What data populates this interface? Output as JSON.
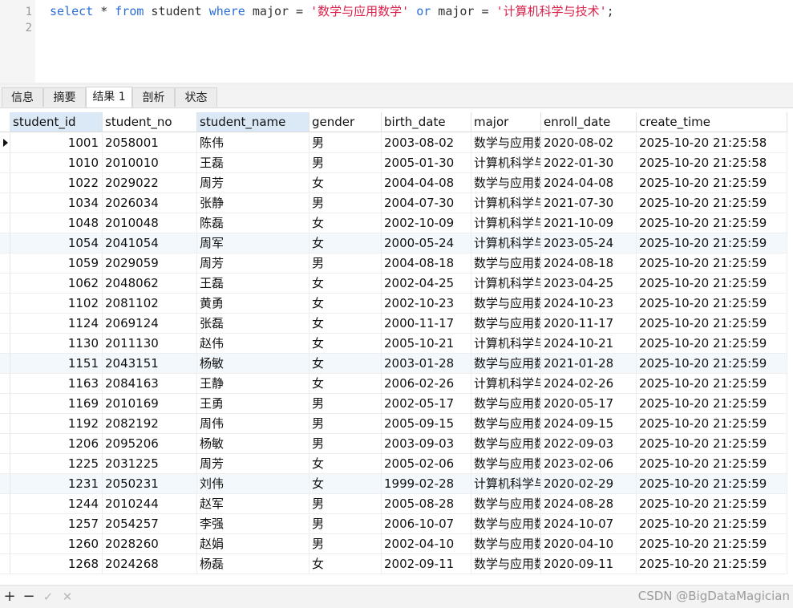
{
  "editor": {
    "line_numbers": [
      "1",
      "2"
    ],
    "sql": {
      "kw_select": "select",
      "t1": " * ",
      "kw_from": "from",
      "t2": " student ",
      "kw_where": "where",
      "t3": " major = ",
      "str1": "'数学与应用数学'",
      "t4": " ",
      "kw_or": "or",
      "t5": " major = ",
      "str2": "'计算机科学与技术'",
      "t6": ";"
    }
  },
  "tabs": [
    {
      "label": "信息"
    },
    {
      "label": "摘要"
    },
    {
      "label": "结果 1"
    },
    {
      "label": "剖析"
    },
    {
      "label": "状态"
    }
  ],
  "grid": {
    "columns": [
      "student_id",
      "student_no",
      "student_name",
      "gender",
      "birth_date",
      "major",
      "enroll_date",
      "create_time"
    ],
    "rows": [
      [
        "1001",
        "2058001",
        "陈伟",
        "男",
        "2003-08-02",
        "数学与应用数",
        "2020-08-02",
        "2025-10-20 21:25:58"
      ],
      [
        "1010",
        "2010010",
        "王磊",
        "男",
        "2005-01-30",
        "计算机科学与",
        "2022-01-30",
        "2025-10-20 21:25:58"
      ],
      [
        "1022",
        "2029022",
        "周芳",
        "女",
        "2004-04-08",
        "数学与应用数",
        "2024-04-08",
        "2025-10-20 21:25:59"
      ],
      [
        "1034",
        "2026034",
        "张静",
        "男",
        "2004-07-30",
        "计算机科学与",
        "2021-07-30",
        "2025-10-20 21:25:59"
      ],
      [
        "1048",
        "2010048",
        "陈磊",
        "女",
        "2002-10-09",
        "计算机科学与",
        "2021-10-09",
        "2025-10-20 21:25:59"
      ],
      [
        "1054",
        "2041054",
        "周军",
        "女",
        "2000-05-24",
        "计算机科学与",
        "2023-05-24",
        "2025-10-20 21:25:59"
      ],
      [
        "1059",
        "2029059",
        "周芳",
        "男",
        "2004-08-18",
        "数学与应用数",
        "2024-08-18",
        "2025-10-20 21:25:59"
      ],
      [
        "1062",
        "2048062",
        "王磊",
        "女",
        "2002-04-25",
        "计算机科学与",
        "2023-04-25",
        "2025-10-20 21:25:59"
      ],
      [
        "1102",
        "2081102",
        "黄勇",
        "女",
        "2002-10-23",
        "数学与应用数",
        "2024-10-23",
        "2025-10-20 21:25:59"
      ],
      [
        "1124",
        "2069124",
        "张磊",
        "女",
        "2000-11-17",
        "数学与应用数",
        "2020-11-17",
        "2025-10-20 21:25:59"
      ],
      [
        "1130",
        "2011130",
        "赵伟",
        "女",
        "2005-10-21",
        "计算机科学与",
        "2024-10-21",
        "2025-10-20 21:25:59"
      ],
      [
        "1151",
        "2043151",
        "杨敏",
        "女",
        "2003-01-28",
        "数学与应用数",
        "2021-01-28",
        "2025-10-20 21:25:59"
      ],
      [
        "1163",
        "2084163",
        "王静",
        "女",
        "2006-02-26",
        "计算机科学与",
        "2024-02-26",
        "2025-10-20 21:25:59"
      ],
      [
        "1169",
        "2010169",
        "王勇",
        "男",
        "2002-05-17",
        "数学与应用数",
        "2020-05-17",
        "2025-10-20 21:25:59"
      ],
      [
        "1192",
        "2082192",
        "周伟",
        "男",
        "2005-09-15",
        "数学与应用数",
        "2024-09-15",
        "2025-10-20 21:25:59"
      ],
      [
        "1206",
        "2095206",
        "杨敏",
        "男",
        "2003-09-03",
        "数学与应用数",
        "2022-09-03",
        "2025-10-20 21:25:59"
      ],
      [
        "1225",
        "2031225",
        "周芳",
        "女",
        "2005-02-06",
        "数学与应用数",
        "2023-02-06",
        "2025-10-20 21:25:59"
      ],
      [
        "1231",
        "2050231",
        "刘伟",
        "女",
        "1999-02-28",
        "计算机科学与",
        "2020-02-29",
        "2025-10-20 21:25:59"
      ],
      [
        "1244",
        "2010244",
        "赵军",
        "男",
        "2005-08-28",
        "数学与应用数",
        "2024-08-28",
        "2025-10-20 21:25:59"
      ],
      [
        "1257",
        "2054257",
        "李强",
        "男",
        "2006-10-07",
        "数学与应用数",
        "2024-10-07",
        "2025-10-20 21:25:59"
      ],
      [
        "1260",
        "2028260",
        "赵娟",
        "男",
        "2002-04-10",
        "数学与应用数",
        "2020-04-10",
        "2025-10-20 21:25:59"
      ],
      [
        "1268",
        "2024268",
        "杨磊",
        "女",
        "2002-09-11",
        "数学与应用数",
        "2020-09-11",
        "2025-10-20 21:25:59"
      ]
    ]
  },
  "bottombar": {
    "add_icon": "+",
    "remove_icon": "−",
    "confirm_icon": "✓",
    "cancel_icon": "✕",
    "watermark": "CSDN @BigDataMagician"
  },
  "colors": {
    "keyword": "#2b6fd6",
    "string": "#d9214a",
    "selected_header": "#dbe9f7",
    "alt_row": "#f3f8fd"
  }
}
